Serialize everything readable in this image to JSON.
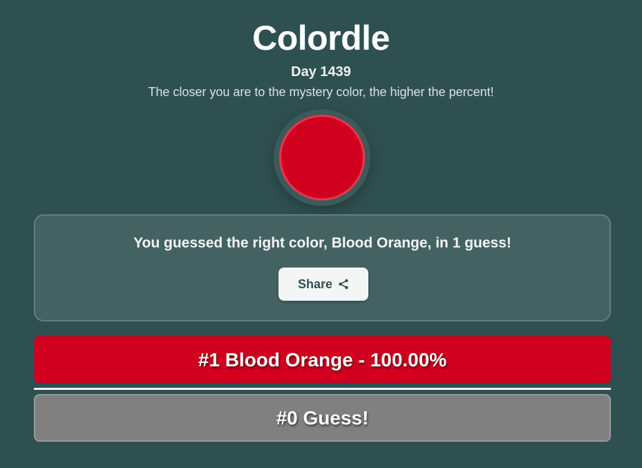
{
  "header": {
    "title": "Colordle",
    "day": "Day 1439",
    "subtitle": "The closer you are to the mystery color, the higher the percent!"
  },
  "swatch": {
    "color": "#d1001f"
  },
  "result": {
    "message": "You guessed the right color, Blood Orange, in 1 guess!",
    "share_label": "Share",
    "share_icon": "share-icon"
  },
  "guesses": [
    {
      "label": "#1 Blood Orange - 100.00%",
      "color": "#d1001f"
    }
  ],
  "next_guess": {
    "label": "#0 Guess!",
    "color": "#808080"
  }
}
